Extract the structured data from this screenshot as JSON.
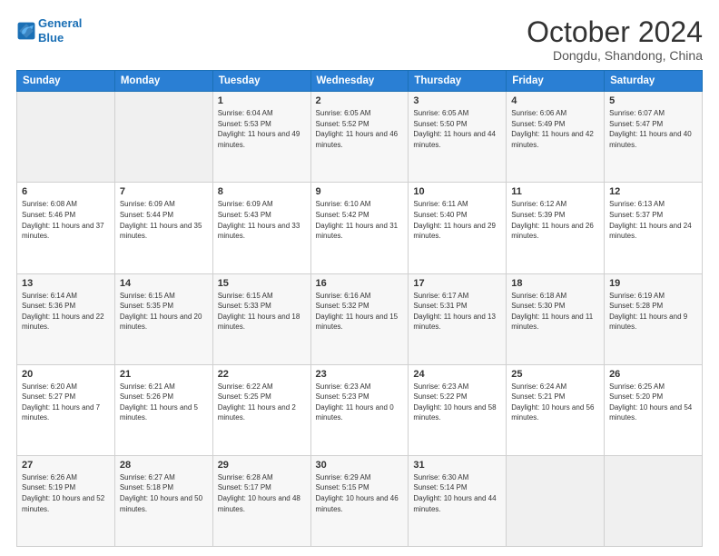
{
  "header": {
    "logo_line1": "General",
    "logo_line2": "Blue",
    "month": "October 2024",
    "location": "Dongdu, Shandong, China"
  },
  "weekdays": [
    "Sunday",
    "Monday",
    "Tuesday",
    "Wednesday",
    "Thursday",
    "Friday",
    "Saturday"
  ],
  "weeks": [
    [
      {
        "day": "",
        "info": ""
      },
      {
        "day": "",
        "info": ""
      },
      {
        "day": "1",
        "info": "Sunrise: 6:04 AM\nSunset: 5:53 PM\nDaylight: 11 hours and 49 minutes."
      },
      {
        "day": "2",
        "info": "Sunrise: 6:05 AM\nSunset: 5:52 PM\nDaylight: 11 hours and 46 minutes."
      },
      {
        "day": "3",
        "info": "Sunrise: 6:05 AM\nSunset: 5:50 PM\nDaylight: 11 hours and 44 minutes."
      },
      {
        "day": "4",
        "info": "Sunrise: 6:06 AM\nSunset: 5:49 PM\nDaylight: 11 hours and 42 minutes."
      },
      {
        "day": "5",
        "info": "Sunrise: 6:07 AM\nSunset: 5:47 PM\nDaylight: 11 hours and 40 minutes."
      }
    ],
    [
      {
        "day": "6",
        "info": "Sunrise: 6:08 AM\nSunset: 5:46 PM\nDaylight: 11 hours and 37 minutes."
      },
      {
        "day": "7",
        "info": "Sunrise: 6:09 AM\nSunset: 5:44 PM\nDaylight: 11 hours and 35 minutes."
      },
      {
        "day": "8",
        "info": "Sunrise: 6:09 AM\nSunset: 5:43 PM\nDaylight: 11 hours and 33 minutes."
      },
      {
        "day": "9",
        "info": "Sunrise: 6:10 AM\nSunset: 5:42 PM\nDaylight: 11 hours and 31 minutes."
      },
      {
        "day": "10",
        "info": "Sunrise: 6:11 AM\nSunset: 5:40 PM\nDaylight: 11 hours and 29 minutes."
      },
      {
        "day": "11",
        "info": "Sunrise: 6:12 AM\nSunset: 5:39 PM\nDaylight: 11 hours and 26 minutes."
      },
      {
        "day": "12",
        "info": "Sunrise: 6:13 AM\nSunset: 5:37 PM\nDaylight: 11 hours and 24 minutes."
      }
    ],
    [
      {
        "day": "13",
        "info": "Sunrise: 6:14 AM\nSunset: 5:36 PM\nDaylight: 11 hours and 22 minutes."
      },
      {
        "day": "14",
        "info": "Sunrise: 6:15 AM\nSunset: 5:35 PM\nDaylight: 11 hours and 20 minutes."
      },
      {
        "day": "15",
        "info": "Sunrise: 6:15 AM\nSunset: 5:33 PM\nDaylight: 11 hours and 18 minutes."
      },
      {
        "day": "16",
        "info": "Sunrise: 6:16 AM\nSunset: 5:32 PM\nDaylight: 11 hours and 15 minutes."
      },
      {
        "day": "17",
        "info": "Sunrise: 6:17 AM\nSunset: 5:31 PM\nDaylight: 11 hours and 13 minutes."
      },
      {
        "day": "18",
        "info": "Sunrise: 6:18 AM\nSunset: 5:30 PM\nDaylight: 11 hours and 11 minutes."
      },
      {
        "day": "19",
        "info": "Sunrise: 6:19 AM\nSunset: 5:28 PM\nDaylight: 11 hours and 9 minutes."
      }
    ],
    [
      {
        "day": "20",
        "info": "Sunrise: 6:20 AM\nSunset: 5:27 PM\nDaylight: 11 hours and 7 minutes."
      },
      {
        "day": "21",
        "info": "Sunrise: 6:21 AM\nSunset: 5:26 PM\nDaylight: 11 hours and 5 minutes."
      },
      {
        "day": "22",
        "info": "Sunrise: 6:22 AM\nSunset: 5:25 PM\nDaylight: 11 hours and 2 minutes."
      },
      {
        "day": "23",
        "info": "Sunrise: 6:23 AM\nSunset: 5:23 PM\nDaylight: 11 hours and 0 minutes."
      },
      {
        "day": "24",
        "info": "Sunrise: 6:23 AM\nSunset: 5:22 PM\nDaylight: 10 hours and 58 minutes."
      },
      {
        "day": "25",
        "info": "Sunrise: 6:24 AM\nSunset: 5:21 PM\nDaylight: 10 hours and 56 minutes."
      },
      {
        "day": "26",
        "info": "Sunrise: 6:25 AM\nSunset: 5:20 PM\nDaylight: 10 hours and 54 minutes."
      }
    ],
    [
      {
        "day": "27",
        "info": "Sunrise: 6:26 AM\nSunset: 5:19 PM\nDaylight: 10 hours and 52 minutes."
      },
      {
        "day": "28",
        "info": "Sunrise: 6:27 AM\nSunset: 5:18 PM\nDaylight: 10 hours and 50 minutes."
      },
      {
        "day": "29",
        "info": "Sunrise: 6:28 AM\nSunset: 5:17 PM\nDaylight: 10 hours and 48 minutes."
      },
      {
        "day": "30",
        "info": "Sunrise: 6:29 AM\nSunset: 5:15 PM\nDaylight: 10 hours and 46 minutes."
      },
      {
        "day": "31",
        "info": "Sunrise: 6:30 AM\nSunset: 5:14 PM\nDaylight: 10 hours and 44 minutes."
      },
      {
        "day": "",
        "info": ""
      },
      {
        "day": "",
        "info": ""
      }
    ]
  ]
}
